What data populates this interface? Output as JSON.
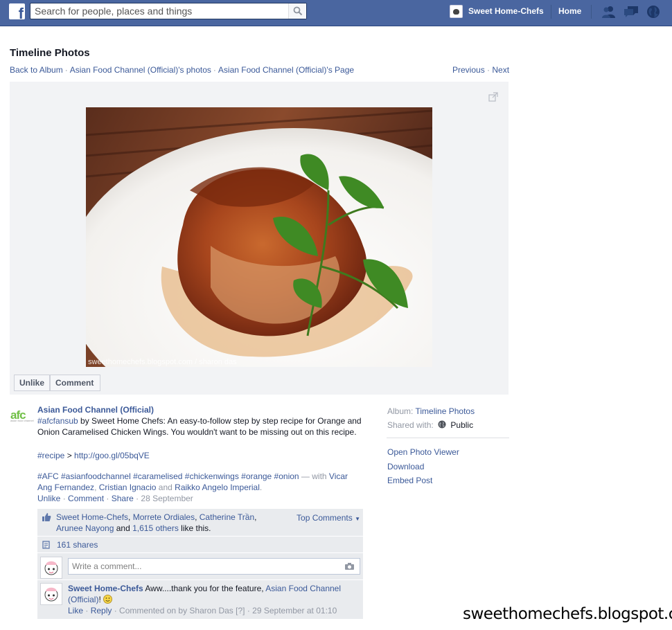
{
  "topbar": {
    "search_placeholder": "Search for people, places and things",
    "profile_name": "Sweet Home-Chefs",
    "home_label": "Home",
    "icons": [
      "friend-requests-icon",
      "messages-icon",
      "notifications-globe-icon"
    ]
  },
  "header": {
    "title": "Timeline Photos",
    "breadcrumbs": [
      "Back to Album",
      "Asian Food Channel (Official)'s photos",
      "Asian Food Channel (Official)'s Page"
    ],
    "previous_label": "Previous",
    "next_label": "Next"
  },
  "photo": {
    "watermark": "sweethomechefs.blogspot.com / sharon das"
  },
  "actions": {
    "unlike_label": "Unlike",
    "comment_label": "Comment"
  },
  "post": {
    "author_logo": "afc",
    "author_logo_sub": "asian food channel",
    "author": "Asian Food Channel (Official)",
    "hashtag_fansub": "#afcfansub",
    "text_intro": " by Sweet Home Chefs: An easy-to-follow step by step recipe for Orange and Onion Caramelised Chicken Wings. You wouldn't want to be missing out on this recipe.",
    "recipe_tag": "#recipe",
    "recipe_sep": " > ",
    "recipe_link": "http://goo.gl/05bqVE",
    "hashtags": "#AFC #asianfoodchannel #caramelised #chickenwings #orange #onion",
    "with_text": " — with ",
    "tagged": [
      "Vicar Ang Fernandez",
      "Cristian Ignacio",
      "Raikko Angelo Imperial"
    ],
    "and_text": " and ",
    "meta_links": [
      "Unlike",
      "Comment",
      "Share"
    ],
    "date": "28 September"
  },
  "ufi": {
    "likers": [
      "Sweet Home-Chefs",
      "Morrete Ordiales",
      "Catherine Trần",
      "Arunee Nayong"
    ],
    "and_text": "and",
    "others_link": "1,615 others",
    "like_suffix": "like this.",
    "top_comments_label": "Top Comments",
    "shares": "161 shares",
    "write_placeholder": "Write a comment...",
    "comment": {
      "author": "Sweet Home-Chefs",
      "text": "Aww....thank you for the feature,",
      "mention": "Asian Food Channel (Official)",
      "suffix": "!",
      "like_label": "Like",
      "reply_label": "Reply",
      "by_text": "Commented on by Sharon Das",
      "help": "[?]",
      "time": "29 September at 01:10"
    }
  },
  "side": {
    "album_label": "Album:",
    "album_value": "Timeline Photos",
    "shared_label": "Shared with:",
    "shared_value": "Public",
    "links": [
      "Open Photo Viewer",
      "Download",
      "Embed Post"
    ]
  },
  "blog_watermark": "sweethomechefs.blogspot.com",
  "colors": {
    "topbar": "#4a66a0",
    "link": "#3b5998",
    "stage": "#f2f3f5",
    "ufi": "#e9ebee",
    "afc_green": "#6fbf44"
  }
}
